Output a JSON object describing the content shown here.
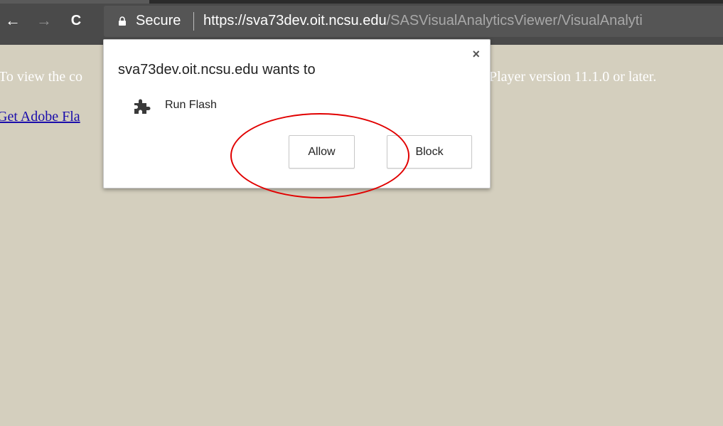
{
  "browser": {
    "nav": {
      "back_glyph": "←",
      "forward_glyph": "→",
      "reload_glyph": "C"
    },
    "omnibox": {
      "secure_label": "Secure",
      "url_host": "https://sva73dev.oit.ncsu.edu",
      "url_path": "/SASVisualAnalyticsViewer/VisualAnalyti"
    }
  },
  "page": {
    "message_left": "To view the co",
    "message_right": "Player version 11.1.0 or later.",
    "link_text": "Get Adobe Fla"
  },
  "permission_popup": {
    "title": "sva73dev.oit.ncsu.edu wants to",
    "permission_label": "Run Flash",
    "permission_icon": "puzzle-piece-icon",
    "close_glyph": "×",
    "allow_label": "Allow",
    "block_label": "Block"
  },
  "annotation": {
    "highlight_color": "#e10000"
  }
}
